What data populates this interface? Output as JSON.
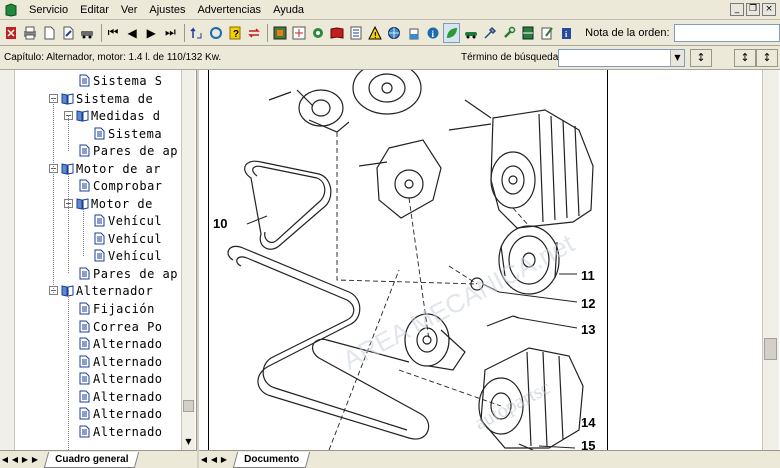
{
  "menubar": {
    "items": [
      "Servicio",
      "Editar",
      "Ver",
      "Ajustes",
      "Advertencias",
      "Ayuda"
    ]
  },
  "toolbar": {
    "watermark": "AREA MECANICA.net",
    "order_label": "Nota de la orden:",
    "order_value": ""
  },
  "infobar": {
    "chapter_text": "Capítulo: Alternador, motor: 1.4 l. de 110/132 Kw.",
    "search_label": "Término de búsqueda:",
    "search_value": ""
  },
  "tree": {
    "items": [
      {
        "label": "Sistema S",
        "icon": "document-icon"
      },
      {
        "label": "Sistema de",
        "icon": "book-icon",
        "expander": "minus"
      },
      {
        "label": "Medidas d",
        "icon": "book-icon",
        "expander": "minus"
      },
      {
        "label": "Sistema",
        "icon": "document-icon"
      },
      {
        "label": "Pares de ap",
        "icon": "document-icon"
      },
      {
        "label": "Motor de ar",
        "icon": "book-icon",
        "expander": "minus"
      },
      {
        "label": "Comprobar",
        "icon": "document-icon"
      },
      {
        "label": "Motor de",
        "icon": "book-icon",
        "expander": "minus"
      },
      {
        "label": "Vehícul",
        "icon": "document-icon"
      },
      {
        "label": "Vehícul",
        "icon": "document-icon"
      },
      {
        "label": "Vehícul",
        "icon": "document-icon"
      },
      {
        "label": "Pares de ap",
        "icon": "document-icon"
      },
      {
        "label": "Alternador",
        "icon": "book-icon",
        "expander": "minus"
      },
      {
        "label": "Fijación",
        "icon": "document-icon"
      },
      {
        "label": "Correa Po",
        "icon": "document-icon"
      },
      {
        "label": "Alternado",
        "icon": "document-icon"
      },
      {
        "label": "Alternado",
        "icon": "document-icon"
      },
      {
        "label": "Alternado",
        "icon": "document-icon"
      },
      {
        "label": "Alternado",
        "icon": "document-icon"
      },
      {
        "label": "Alternado",
        "icon": "document-icon"
      },
      {
        "label": "Alternado",
        "icon": "document-icon"
      }
    ]
  },
  "tabs": {
    "left": "Cuadro general",
    "right": "Documento"
  },
  "diagram": {
    "callouts": [
      "10",
      "11",
      "12",
      "13",
      "14",
      "15"
    ],
    "watermarks": [
      "AREA MECANICA.net",
      "autopartsc"
    ]
  },
  "colors": {
    "chrome": "#ece9d8",
    "tree_icon_blue": "#1a3d9a",
    "diagram_line": "#222222"
  }
}
